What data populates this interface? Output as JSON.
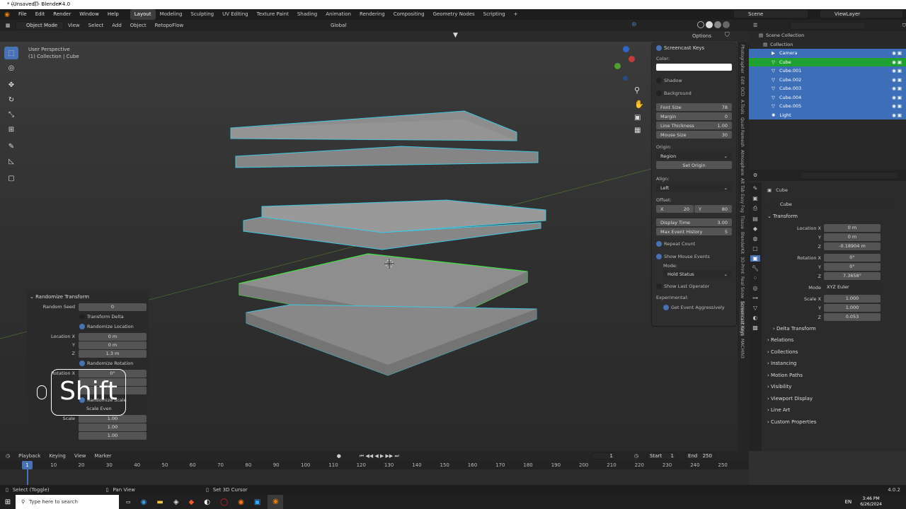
{
  "window": {
    "title": "* (Unsaved) - Blender 4.0",
    "min": "–",
    "max": "❐",
    "close": "✕"
  },
  "menus": [
    "File",
    "Edit",
    "Render",
    "Window",
    "Help"
  ],
  "workspaces": [
    "Layout",
    "Modeling",
    "Sculpting",
    "UV Editing",
    "Texture Paint",
    "Shading",
    "Animation",
    "Rendering",
    "Compositing",
    "Geometry Nodes",
    "Scripting"
  ],
  "scene": {
    "label": "Scene",
    "viewlayer": "ViewLayer"
  },
  "header": {
    "mode": "Object Mode",
    "view": "View",
    "select": "Select",
    "add": "Add",
    "object": "Object",
    "addon": "RetopoFlow",
    "orientation": "Global",
    "options": "Options"
  },
  "viewport": {
    "perspective": "User Perspective",
    "collection": "(1) Collection | Cube"
  },
  "screencast": {
    "title": "Screencast Keys",
    "color_label": "Color:",
    "shadow": "Shadow",
    "background": "Background",
    "fields": [
      {
        "label": "Font Size",
        "value": "78"
      },
      {
        "label": "Margin",
        "value": "0"
      },
      {
        "label": "Line Thickness",
        "value": "1.00"
      },
      {
        "label": "Mouse Size",
        "value": "30"
      }
    ],
    "origin_label": "Origin:",
    "origin": "Region",
    "set_origin": "Set Origin",
    "align_label": "Align:",
    "align": "Left",
    "offset_label": "Offset:",
    "offset_x_label": "X",
    "offset_x": "20",
    "offset_y_label": "Y",
    "offset_y": "80",
    "display_time_label": "Display Time",
    "display_time": "3.00",
    "max_history_label": "Max Event History",
    "max_history": "5",
    "repeat_count": "Repeat Count",
    "show_mouse": "Show Mouse Events",
    "mode_label": "Mode:",
    "mode": "Hold Status",
    "show_last_op": "Show Last Operator",
    "experimental": "Experimental:",
    "get_event": "Get Event Aggressively"
  },
  "side_tabs": [
    "Photographer",
    "Edit",
    "OCD",
    "A.Tools",
    "Quad Remesh",
    "Atmosphere",
    "Alt Tab Easy Fog",
    "Tissue",
    "BlenderKit",
    "3D-Print",
    "Real Snow",
    "Screencast Keys",
    "MACHIN3"
  ],
  "outliner": {
    "root": "Scene Collection",
    "collection": "Collection",
    "items": [
      "Camera",
      "Cube",
      "Cube.001",
      "Cube.002",
      "Cube.003",
      "Cube.004",
      "Cube.005",
      "Light"
    ]
  },
  "properties": {
    "object": "Cube",
    "object_data": "Cube",
    "transform": "Transform",
    "location_x_label": "Location X",
    "location_x": "0 m",
    "location_y_label": "Y",
    "location_y": "0 m",
    "location_z_label": "Z",
    "location_z": "-0.18904 m",
    "rotation_x_label": "Rotation X",
    "rotation_x": "0°",
    "rotation_y_label": "Y",
    "rotation_y": "0°",
    "rotation_z_label": "Z",
    "rotation_z": "7.3658°",
    "mode_label": "Mode",
    "mode": "XYZ Euler",
    "scale_x_label": "Scale X",
    "scale_x": "1.000",
    "scale_y_label": "Y",
    "scale_y": "1.000",
    "scale_z_label": "Z",
    "scale_z": "0.053",
    "delta": "Delta Transform",
    "sections": [
      "Relations",
      "Collections",
      "Instancing",
      "Motion Paths",
      "Visibility",
      "Viewport Display",
      "Line Art",
      "Custom Properties"
    ]
  },
  "randomize": {
    "title": "Randomize Transform",
    "seed_label": "Random Seed",
    "seed": "0",
    "transform_delta": "Transform Delta",
    "rand_loc": "Randomize Location",
    "loc_x_label": "Location X",
    "loc_x": "0 m",
    "loc_y_label": "Y",
    "loc_y": "0 m",
    "loc_z_label": "Z",
    "loc_z": "1.3 m",
    "rand_rot": "Randomize Rotation",
    "rot_x_label": "Rotation X",
    "rot_x": "0°",
    "rand_scale": "Randomize Scale",
    "scale_even": "Scale Even",
    "scale_label": "Scale",
    "s1": "1.00",
    "s2": "1.00",
    "s3": "1.00"
  },
  "screencast_overlay": "Shift",
  "timeline": {
    "playback": "Playback",
    "keying": "Keying",
    "view": "View",
    "marker": "Marker",
    "current": "1",
    "start_label": "Start",
    "start": "1",
    "end_label": "End",
    "end": "250",
    "frames": [
      "10",
      "20",
      "30",
      "40",
      "50",
      "60",
      "70",
      "80",
      "90",
      "100",
      "110",
      "120",
      "130",
      "140",
      "150",
      "160",
      "170",
      "180",
      "190",
      "200",
      "210",
      "220",
      "230",
      "240",
      "250"
    ]
  },
  "status": {
    "select": "Select (Toggle)",
    "pan": "Pan View",
    "cursor": "Set 3D Cursor",
    "version": "4.0.2"
  },
  "taskbar": {
    "search": "Type here to search",
    "lang": "EN",
    "time": "3:46 PM",
    "date": "6/26/2024"
  },
  "colors": {
    "accent": "#4772b3",
    "active": "#1fa132",
    "outline": "#3fc6e0"
  }
}
